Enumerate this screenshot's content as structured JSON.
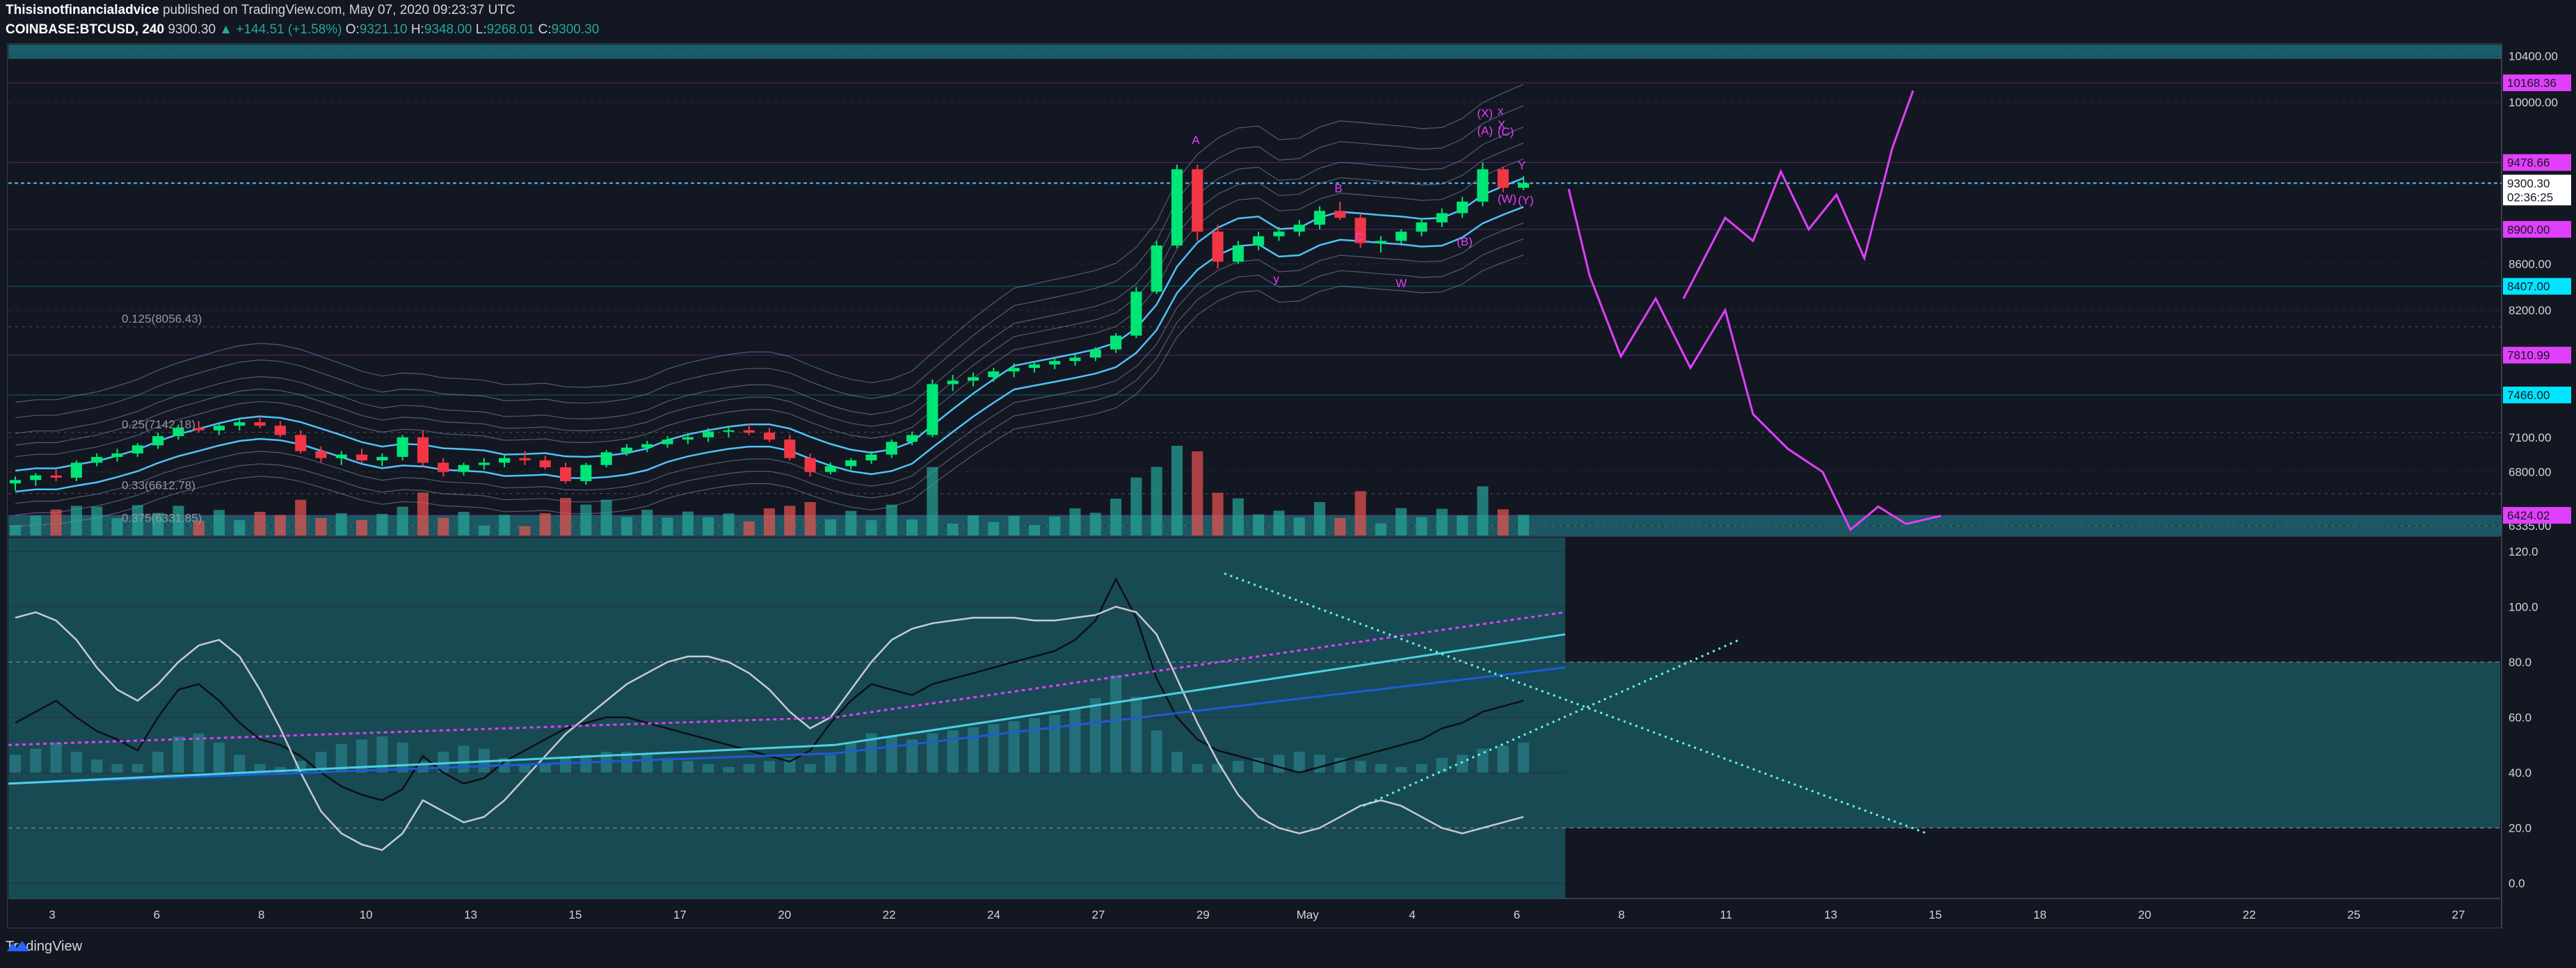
{
  "header": {
    "author": "Thisisnotfinancialadvice",
    "published": "published on TradingView.com, May 07, 2020 09:23:37 UTC",
    "symbol": "COINBASE:BTCUSD, 240",
    "last": "9300.30",
    "change": "▲ +144.51 (+1.58%)",
    "o_label": "O:",
    "o_val": "9321.10",
    "h_label": "H:",
    "h_val": "9348.00",
    "l_label": "L:",
    "l_val": "9268.01",
    "c_label": "C:",
    "c_val": "9300.30"
  },
  "footer": {
    "brand": "TradingView"
  },
  "colors": {
    "background": "#131722",
    "up_candle": "#00e676",
    "down_candle": "#f23645",
    "band": "#4fc3f7",
    "teal_box": "#1d6f7a",
    "magenta": "#e040fb",
    "cyan_tag": "#00e5ff",
    "vol_green": "#26a69a",
    "vol_red": "#ef5350"
  },
  "chart_data": [
    {
      "type": "candlestick",
      "title": "",
      "y_axis_ticks": [
        "10400.00",
        "10000.00",
        "8600.00",
        "8200.00",
        "7100.00",
        "6800.00",
        "6335.00"
      ],
      "ylim": [
        6250,
        10500
      ],
      "price_tags": [
        {
          "label": "10168.36",
          "color": "#e040fb"
        },
        {
          "label": "9478.66",
          "color": "#e040fb"
        },
        {
          "label": "9300.30",
          "color": "#ffffff"
        },
        {
          "label": "02:36:25",
          "color": "#ffffff"
        },
        {
          "label": "8900.00",
          "color": "#e040fb"
        },
        {
          "label": "8407.00",
          "color": "#00e5ff"
        },
        {
          "label": "7810.99",
          "color": "#e040fb"
        },
        {
          "label": "7466.00",
          "color": "#00e5ff"
        },
        {
          "label": "6424.02",
          "color": "#e040fb"
        }
      ],
      "fib_labels": [
        "0.125(8056.43)",
        "0.25(7142.18)",
        "0.33(6612.78)",
        "0.375(6331.85)"
      ],
      "wave_labels": [
        "A",
        "B",
        "C",
        "W",
        "X",
        "Y",
        "(A)",
        "(B)",
        "(C)",
        "(W)",
        "(X)",
        "(Y)",
        "x",
        "y"
      ],
      "x_ticks": [
        "3",
        "6",
        "8",
        "10",
        "13",
        "15",
        "17",
        "20",
        "22",
        "24",
        "27",
        "29",
        "May",
        "4",
        "6",
        "8",
        "11",
        "13",
        "15",
        "18",
        "20",
        "22",
        "25",
        "27"
      ],
      "series": [
        {
          "name": "",
          "values": [
            [
              6700,
              6760,
              6640,
              6730
            ],
            [
              6730,
              6790,
              6680,
              6770
            ],
            [
              6770,
              6820,
              6720,
              6750
            ],
            [
              6750,
              6900,
              6720,
              6880
            ],
            [
              6880,
              6960,
              6850,
              6930
            ],
            [
              6930,
              7000,
              6890,
              6960
            ],
            [
              6960,
              7050,
              6930,
              7030
            ],
            [
              7030,
              7140,
              7000,
              7110
            ],
            [
              7110,
              7210,
              7080,
              7180
            ],
            [
              7180,
              7240,
              7140,
              7160
            ],
            [
              7160,
              7220,
              7120,
              7200
            ],
            [
              7200,
              7260,
              7160,
              7230
            ],
            [
              7230,
              7280,
              7180,
              7200
            ],
            [
              7200,
              7240,
              7100,
              7120
            ],
            [
              7120,
              7160,
              6960,
              6980
            ],
            [
              6980,
              7020,
              6880,
              6920
            ],
            [
              6920,
              6980,
              6860,
              6950
            ],
            [
              6950,
              7000,
              6880,
              6900
            ],
            [
              6900,
              6960,
              6850,
              6930
            ],
            [
              6930,
              7120,
              6900,
              7100
            ],
            [
              7100,
              7160,
              6850,
              6880
            ],
            [
              6880,
              6920,
              6760,
              6800
            ],
            [
              6800,
              6880,
              6770,
              6860
            ],
            [
              6860,
              6920,
              6820,
              6880
            ],
            [
              6880,
              6950,
              6840,
              6920
            ],
            [
              6920,
              6980,
              6860,
              6900
            ],
            [
              6900,
              6940,
              6820,
              6840
            ],
            [
              6840,
              6880,
              6700,
              6720
            ],
            [
              6720,
              6880,
              6690,
              6860
            ],
            [
              6860,
              6990,
              6840,
              6970
            ],
            [
              6970,
              7040,
              6940,
              7010
            ],
            [
              7010,
              7070,
              6970,
              7040
            ],
            [
              7040,
              7110,
              7010,
              7080
            ],
            [
              7080,
              7140,
              7040,
              7100
            ],
            [
              7100,
              7180,
              7060,
              7150
            ],
            [
              7150,
              7200,
              7100,
              7160
            ],
            [
              7160,
              7220,
              7120,
              7140
            ],
            [
              7140,
              7180,
              7060,
              7080
            ],
            [
              7080,
              7120,
              6900,
              6920
            ],
            [
              6920,
              6960,
              6760,
              6800
            ],
            [
              6800,
              6880,
              6780,
              6850
            ],
            [
              6850,
              6920,
              6820,
              6900
            ],
            [
              6900,
              6980,
              6870,
              6950
            ],
            [
              6950,
              7080,
              6920,
              7060
            ],
            [
              7060,
              7150,
              7030,
              7120
            ],
            [
              7120,
              7600,
              7100,
              7560
            ],
            [
              7560,
              7640,
              7500,
              7590
            ],
            [
              7590,
              7660,
              7540,
              7620
            ],
            [
              7620,
              7700,
              7580,
              7670
            ],
            [
              7670,
              7740,
              7620,
              7700
            ],
            [
              7700,
              7760,
              7660,
              7730
            ],
            [
              7730,
              7790,
              7690,
              7760
            ],
            [
              7760,
              7820,
              7720,
              7790
            ],
            [
              7790,
              7880,
              7760,
              7860
            ],
            [
              7860,
              8000,
              7830,
              7980
            ],
            [
              7980,
              8400,
              7960,
              8360
            ],
            [
              8360,
              8800,
              8340,
              8760
            ],
            [
              8760,
              9460,
              8740,
              9420
            ],
            [
              9420,
              9460,
              8800,
              8880
            ],
            [
              8880,
              8940,
              8560,
              8620
            ],
            [
              8620,
              8800,
              8600,
              8760
            ],
            [
              8760,
              8880,
              8720,
              8840
            ],
            [
              8840,
              8920,
              8800,
              8880
            ],
            [
              8880,
              8980,
              8840,
              8940
            ],
            [
              8940,
              9100,
              8900,
              9060
            ],
            [
              9060,
              9140,
              8980,
              9000
            ],
            [
              9000,
              9040,
              8740,
              8780
            ],
            [
              8780,
              8840,
              8700,
              8800
            ],
            [
              8800,
              8900,
              8760,
              8880
            ],
            [
              8880,
              9000,
              8840,
              8960
            ],
            [
              8960,
              9080,
              8920,
              9040
            ],
            [
              9040,
              9180,
              9000,
              9140
            ],
            [
              9140,
              9480,
              9100,
              9420
            ],
            [
              9420,
              9440,
              9220,
              9260
            ],
            [
              9260,
              9360,
              9240,
              9300
            ]
          ]
        }
      ]
    },
    {
      "type": "line",
      "title": "",
      "y_axis_ticks": [
        "120.0",
        "100.0",
        "80.0",
        "60.0",
        "40.0",
        "20.0",
        "0.0"
      ],
      "ylim": [
        -5,
        125
      ],
      "levels": [
        80,
        20
      ],
      "series": [
        {
          "name": "",
          "values": [
            58,
            62,
            66,
            60,
            55,
            52,
            48,
            60,
            70,
            72,
            66,
            58,
            52,
            50,
            46,
            40,
            35,
            32,
            30,
            34,
            46,
            40,
            36,
            38,
            44,
            48,
            52,
            56,
            58,
            60,
            60,
            58,
            56,
            54,
            52,
            50,
            48,
            46,
            44,
            48,
            58,
            66,
            72,
            70,
            68,
            72,
            74,
            76,
            78,
            80,
            82,
            84,
            88,
            95,
            110,
            96,
            74,
            60,
            52,
            48,
            46,
            44,
            42,
            40,
            42,
            44,
            46,
            48,
            50,
            52,
            56,
            58,
            62,
            64,
            66
          ]
        },
        {
          "name": "",
          "values": [
            96,
            98,
            95,
            88,
            78,
            70,
            66,
            72,
            80,
            86,
            88,
            82,
            70,
            56,
            40,
            26,
            18,
            14,
            12,
            18,
            30,
            26,
            22,
            24,
            30,
            38,
            46,
            54,
            60,
            66,
            72,
            76,
            80,
            82,
            82,
            80,
            76,
            70,
            62,
            56,
            60,
            70,
            80,
            88,
            92,
            94,
            95,
            96,
            96,
            96,
            95,
            95,
            96,
            97,
            100,
            98,
            90,
            74,
            58,
            44,
            32,
            24,
            20,
            18,
            20,
            24,
            28,
            30,
            28,
            24,
            20,
            18,
            20,
            22,
            24
          ]
        }
      ]
    }
  ]
}
